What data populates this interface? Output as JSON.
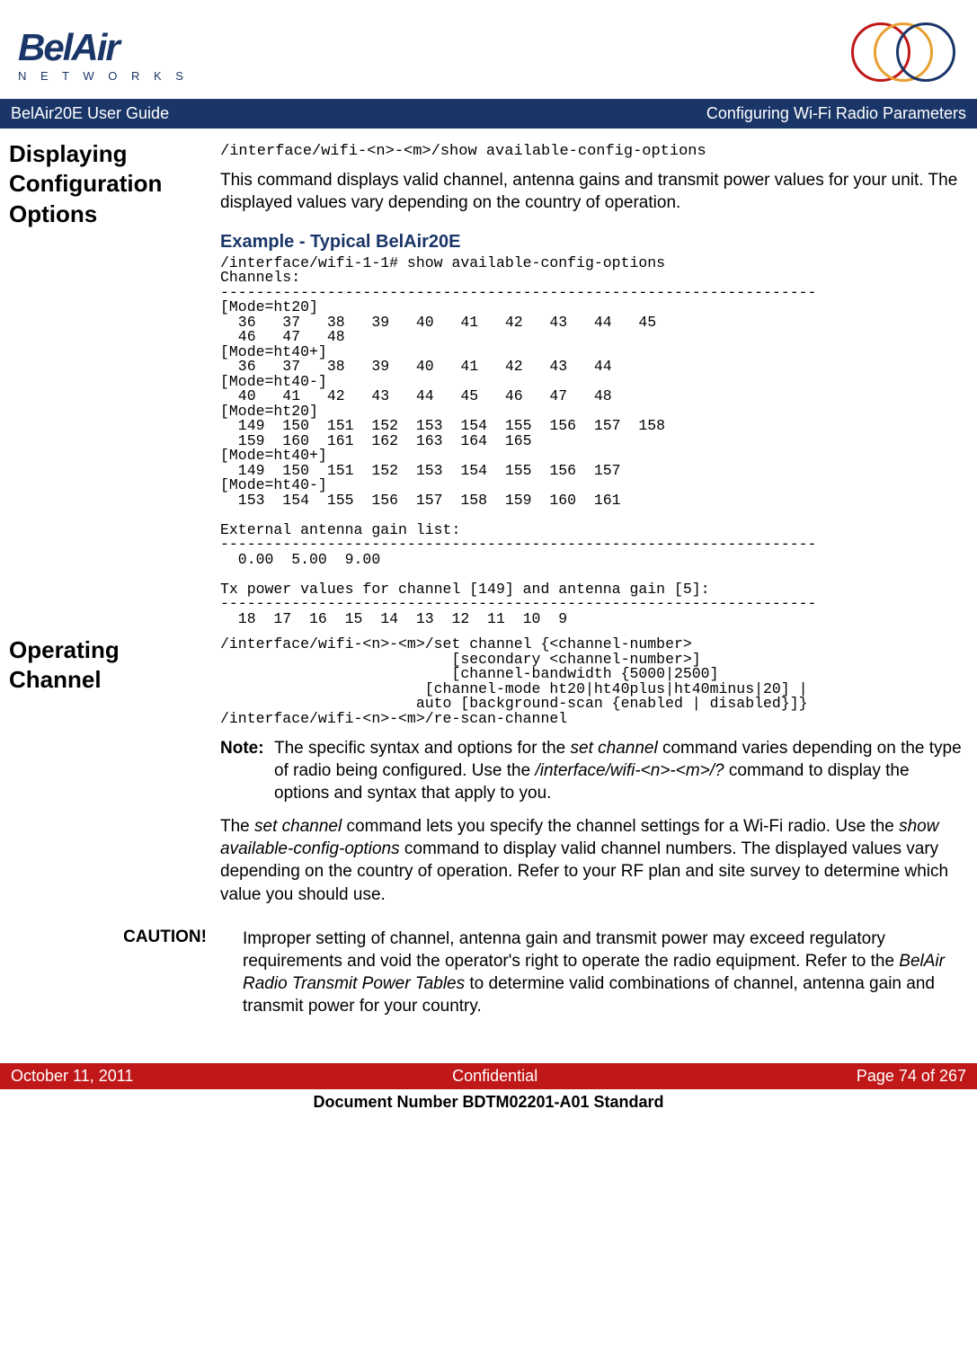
{
  "header": {
    "brand": "BelAir",
    "brandSub": "N E T W O R K S"
  },
  "titleBar": {
    "left": "BelAir20E User Guide",
    "right": "Configuring Wi-Fi Radio Parameters"
  },
  "sections": {
    "displaying": {
      "title": "Displaying Configuration Options",
      "cmd": "/interface/wifi-<n>-<m>/show available-config-options",
      "para": "This command displays valid channel, antenna gains and transmit power values for your unit. The displayed values vary depending on the country of operation.",
      "exampleHeader": "Example - Typical BelAir20E",
      "exampleText": "/interface/wifi-1-1# show available-config-options\nChannels:\n-------------------------------------------------------------------\n[Mode=ht20]\n  36   37   38   39   40   41   42   43   44   45\n  46   47   48\n[Mode=ht40+]\n  36   37   38   39   40   41   42   43   44\n[Mode=ht40-]\n  40   41   42   43   44   45   46   47   48\n[Mode=ht20]\n  149  150  151  152  153  154  155  156  157  158\n  159  160  161  162  163  164  165\n[Mode=ht40+]\n  149  150  151  152  153  154  155  156  157\n[Mode=ht40-]\n  153  154  155  156  157  158  159  160  161\n\nExternal antenna gain list:\n-------------------------------------------------------------------\n  0.00  5.00  9.00\n\nTx power values for channel [149] and antenna gain [5]:\n-------------------------------------------------------------------\n  18  17  16  15  14  13  12  11  10  9"
    },
    "operating": {
      "title": "Operating Channel",
      "cmd": "/interface/wifi-<n>-<m>/set channel {<channel-number>\n                          [secondary <channel-number>]\n                          [channel-bandwidth {5000|2500]\n                       [channel-mode ht20|ht40plus|ht40minus|20] |\n                      auto [background-scan {enabled | disabled}]}\n/interface/wifi-<n>-<m>/re-scan-channel",
      "noteLabel": "Note:",
      "noteText1": "The specific syntax and options for the ",
      "noteCmd1": "set channel",
      "noteText2": " command varies depending on the type of radio being configured. Use the ",
      "noteCmd2": "/interface/wifi-<n>-<m>/?",
      "noteText3": " command to display the options and syntax that apply to you.",
      "para1a": "The ",
      "para1cmd1": "set channel",
      "para1b": " command lets you specify the channel settings for a Wi-Fi radio. Use the ",
      "para1cmd2": "show available-config-options",
      "para1c": " command to display valid channel numbers. The displayed values vary depending on the country of operation. Refer to your RF plan and site survey to determine which value you should use."
    },
    "caution": {
      "label": "CAUTION!",
      "text1": "Improper setting of channel, antenna gain and transmit power may exceed regulatory requirements and void the operator's right to operate the radio equipment. Refer to the ",
      "textCmd": "BelAir Radio Transmit Power Tables",
      "text2": " to determine valid combinations of channel, antenna gain and transmit power for your country."
    }
  },
  "footer": {
    "date": "October 11, 2011",
    "center": "Confidential",
    "page": "Page 74 of 267",
    "doc": "Document Number BDTM02201-A01 Standard"
  }
}
